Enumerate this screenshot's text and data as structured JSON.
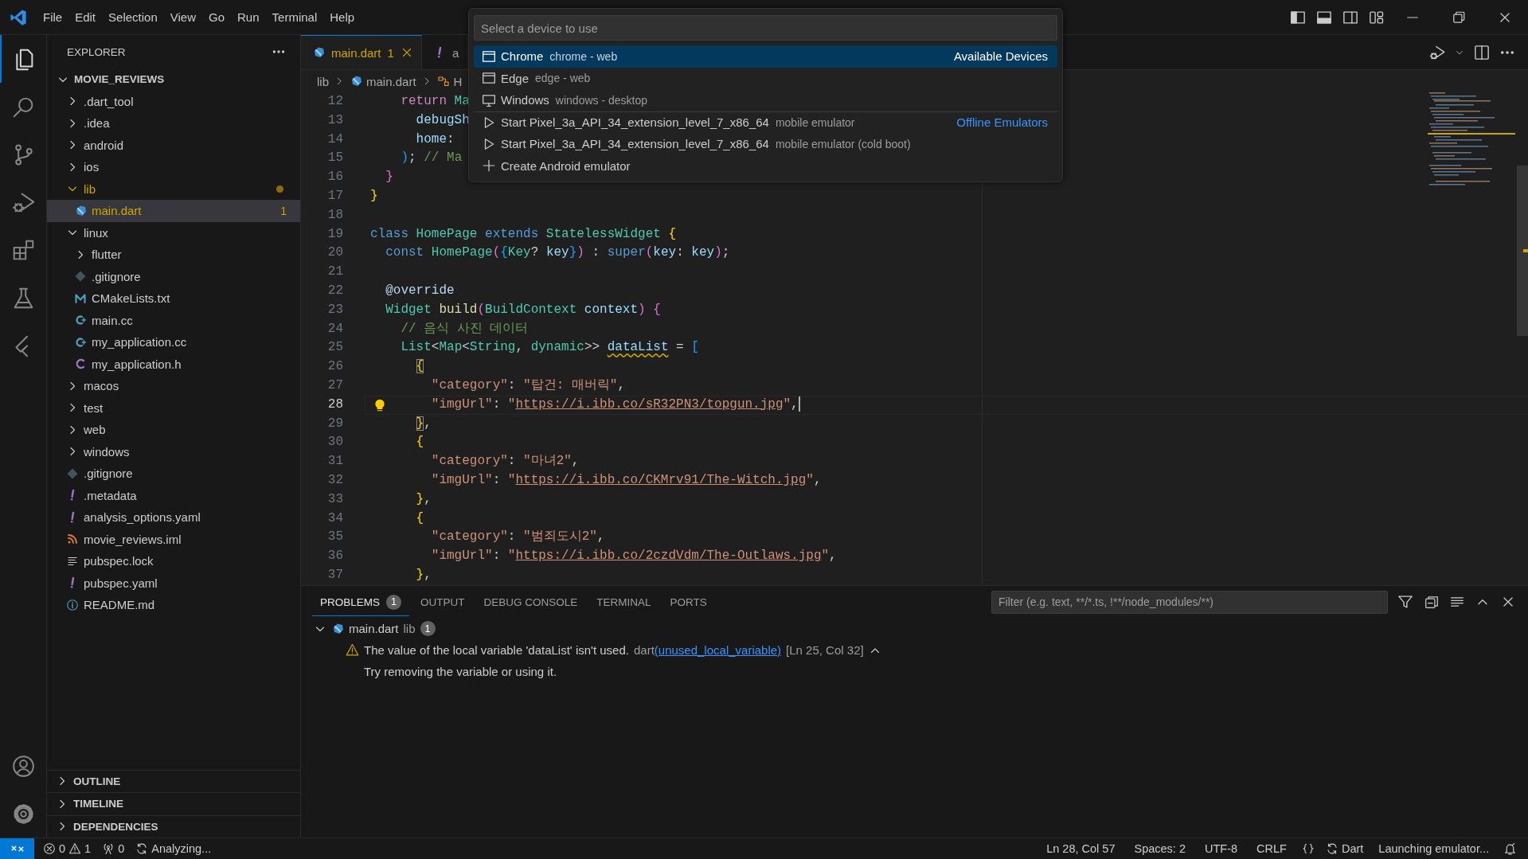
{
  "menu": [
    "File",
    "Edit",
    "Selection",
    "View",
    "Go",
    "Run",
    "Terminal",
    "Help"
  ],
  "activity_bar": [
    {
      "kind": "explorer",
      "selected": true
    },
    {
      "kind": "search",
      "selected": false
    },
    {
      "kind": "source-control",
      "selected": false
    },
    {
      "kind": "run-debug",
      "selected": false
    },
    {
      "kind": "extensions",
      "selected": false
    },
    {
      "kind": "testing",
      "selected": false
    },
    {
      "kind": "flutter",
      "selected": false
    }
  ],
  "sidebar": {
    "title": "EXPLORER",
    "root": {
      "label": "MOVIE_REVIEWS",
      "expanded": true
    },
    "tree": [
      {
        "label": ".dart_tool",
        "kind": "folder",
        "expanded": false,
        "selected": false,
        "has_problems": false
      },
      {
        "label": ".idea",
        "kind": "folder",
        "expanded": false,
        "selected": false,
        "has_problems": false
      },
      {
        "label": "android",
        "kind": "folder",
        "expanded": false,
        "selected": false,
        "has_problems": false
      },
      {
        "label": "ios",
        "kind": "folder",
        "expanded": false,
        "selected": false,
        "has_problems": false
      },
      {
        "label": "lib",
        "kind": "folder",
        "expanded": true,
        "selected": false,
        "has_problems": true,
        "children": [
          {
            "label": "main.dart",
            "kind": "dart",
            "selected": true,
            "has_problems": true,
            "badge": "1"
          }
        ]
      },
      {
        "label": "linux",
        "kind": "folder",
        "expanded": true,
        "selected": false,
        "has_problems": false,
        "children": [
          {
            "label": "flutter",
            "kind": "folder",
            "expanded": false,
            "selected": false,
            "has_problems": false
          },
          {
            "label": ".gitignore",
            "kind": "gitignore",
            "selected": false,
            "has_problems": false
          },
          {
            "label": "CMakeLists.txt",
            "kind": "cmake",
            "selected": false,
            "has_problems": false
          },
          {
            "label": "main.cc",
            "kind": "cpp",
            "selected": false,
            "has_problems": false
          },
          {
            "label": "my_application.cc",
            "kind": "cpp",
            "selected": false,
            "has_problems": false
          },
          {
            "label": "my_application.h",
            "kind": "header",
            "selected": false,
            "has_problems": false
          }
        ]
      },
      {
        "label": "macos",
        "kind": "folder",
        "expanded": false,
        "selected": false,
        "has_problems": false
      },
      {
        "label": "test",
        "kind": "folder",
        "expanded": false,
        "selected": false,
        "has_problems": false
      },
      {
        "label": "web",
        "kind": "folder",
        "expanded": false,
        "selected": false,
        "has_problems": false
      },
      {
        "label": "windows",
        "kind": "folder",
        "expanded": false,
        "selected": false,
        "has_problems": false
      },
      {
        "label": ".gitignore",
        "kind": "gitignore",
        "selected": false,
        "has_problems": false
      },
      {
        "label": ".metadata",
        "kind": "yaml",
        "selected": false,
        "has_problems": false
      },
      {
        "label": "analysis_options.yaml",
        "kind": "yaml",
        "selected": false,
        "has_problems": false
      },
      {
        "label": "movie_reviews.iml",
        "kind": "iml",
        "selected": false,
        "has_problems": false
      },
      {
        "label": "pubspec.lock",
        "kind": "lock",
        "selected": false,
        "has_problems": false
      },
      {
        "label": "pubspec.yaml",
        "kind": "yaml",
        "selected": false,
        "has_problems": false
      },
      {
        "label": "README.md",
        "kind": "markdown",
        "selected": false,
        "has_problems": false
      }
    ],
    "sections": [
      {
        "label": "OUTLINE",
        "expanded": false
      },
      {
        "label": "TIMELINE",
        "expanded": false
      },
      {
        "label": "DEPENDENCIES",
        "expanded": false
      }
    ]
  },
  "editor": {
    "tabs": [
      {
        "label": "main.dart",
        "kind": "dart",
        "badge": "1",
        "selected": true
      },
      {
        "label": "a",
        "kind": "yaml",
        "selected": false
      }
    ],
    "breadcrumb": [
      {
        "label": "lib",
        "kind": "folder"
      },
      {
        "label": "main.dart",
        "kind": "dart"
      },
      {
        "label": "H",
        "kind": "class"
      }
    ],
    "lines": [
      {
        "number": "12",
        "current": false,
        "lightbulb": false,
        "tokens": [
          {
            "text": "    return",
            "kind": "ctrl"
          },
          {
            "text": " Ma",
            "kind": "type"
          }
        ]
      },
      {
        "number": "13",
        "current": false,
        "lightbulb": false,
        "tokens": [
          {
            "text": "      debugSh",
            "kind": "var"
          }
        ]
      },
      {
        "number": "14",
        "current": false,
        "lightbulb": false,
        "tokens": [
          {
            "text": "      home",
            "kind": "var"
          },
          {
            "text": ":",
            "kind": "punc"
          }
        ]
      },
      {
        "number": "15",
        "current": false,
        "lightbulb": false,
        "tokens": [
          {
            "text": "    )",
            "kind": "b3"
          },
          {
            "text": ";",
            "kind": "punc"
          },
          {
            "text": " // Ma",
            "kind": "com"
          }
        ]
      },
      {
        "number": "16",
        "current": false,
        "lightbulb": false,
        "tokens": [
          {
            "text": "  }",
            "kind": "b2"
          }
        ]
      },
      {
        "number": "17",
        "current": false,
        "lightbulb": false,
        "tokens": [
          {
            "text": "}",
            "kind": "b1"
          }
        ]
      },
      {
        "number": "18",
        "current": false,
        "lightbulb": false
      },
      {
        "number": "19",
        "current": false,
        "lightbulb": false,
        "tokens": [
          {
            "text": "class",
            "kind": "kw"
          },
          {
            "text": " HomePage",
            "kind": "type"
          },
          {
            "text": " extends",
            "kind": "kw"
          },
          {
            "text": " StatelessWidget",
            "kind": "type"
          },
          {
            "text": " {",
            "kind": "b1"
          }
        ]
      },
      {
        "number": "20",
        "current": false,
        "lightbulb": false,
        "tokens": [
          {
            "text": "  const",
            "kind": "kw"
          },
          {
            "text": " HomePage",
            "kind": "type"
          },
          {
            "text": "(",
            "kind": "b2"
          },
          {
            "text": "{",
            "kind": "b3"
          },
          {
            "text": "Key",
            "kind": "type"
          },
          {
            "text": "? ",
            "kind": "punc"
          },
          {
            "text": "key",
            "kind": "var"
          },
          {
            "text": "}",
            "kind": "b3"
          },
          {
            "text": ")",
            "kind": "b2"
          },
          {
            "text": " : ",
            "kind": "punc"
          },
          {
            "text": "super",
            "kind": "kw"
          },
          {
            "text": "(",
            "kind": "b2"
          },
          {
            "text": "key",
            "kind": "var"
          },
          {
            "text": ": ",
            "kind": "punc"
          },
          {
            "text": "key",
            "kind": "var"
          },
          {
            "text": ")",
            "kind": "b2"
          },
          {
            "text": ";",
            "kind": "punc"
          }
        ]
      },
      {
        "number": "21",
        "current": false,
        "lightbulb": false
      },
      {
        "number": "22",
        "current": false,
        "lightbulb": false,
        "tokens": [
          {
            "text": "  @override",
            "kind": "meta"
          }
        ]
      },
      {
        "number": "23",
        "current": false,
        "lightbulb": false,
        "tokens": [
          {
            "text": "  Widget",
            "kind": "type"
          },
          {
            "text": " build",
            "kind": "fn"
          },
          {
            "text": "(",
            "kind": "b2"
          },
          {
            "text": "BuildContext",
            "kind": "type"
          },
          {
            "text": " context",
            "kind": "var"
          },
          {
            "text": ")",
            "kind": "b2"
          },
          {
            "text": " {",
            "kind": "b2"
          }
        ]
      },
      {
        "number": "24",
        "current": false,
        "lightbulb": false,
        "tokens": [
          {
            "text": "    // 음식 사진 데이터",
            "kind": "com"
          }
        ]
      },
      {
        "number": "25",
        "current": false,
        "lightbulb": false,
        "tokens": [
          {
            "text": "    List",
            "kind": "type"
          },
          {
            "text": "<",
            "kind": "punc"
          },
          {
            "text": "Map",
            "kind": "type"
          },
          {
            "text": "<",
            "kind": "punc"
          },
          {
            "text": "String",
            "kind": "type"
          },
          {
            "text": ", ",
            "kind": "punc"
          },
          {
            "text": "dynamic",
            "kind": "type"
          },
          {
            "text": ">> ",
            "kind": "punc"
          },
          {
            "text": "dataList",
            "kind": "warn"
          },
          {
            "text": " = ",
            "kind": "punc"
          },
          {
            "text": "[",
            "kind": "b3"
          }
        ]
      },
      {
        "number": "26",
        "current": false,
        "lightbulb": false,
        "tokens": [
          {
            "text": "      {",
            "kind": "match"
          }
        ]
      },
      {
        "number": "27",
        "current": false,
        "lightbulb": false,
        "tokens": [
          {
            "text": "        \"category\"",
            "kind": "str"
          },
          {
            "text": ": ",
            "kind": "punc"
          },
          {
            "text": "\"탑건: 매버릭\"",
            "kind": "str"
          },
          {
            "text": ",",
            "kind": "punc"
          }
        ]
      },
      {
        "number": "28",
        "current": true,
        "lightbulb": true,
        "tokens": [
          {
            "text": "        \"imgUrl\"",
            "kind": "str"
          },
          {
            "text": ": ",
            "kind": "punc"
          },
          {
            "text": "\"",
            "kind": "str"
          },
          {
            "text": "https://i.ibb.co/sR32PN3/topgun.jpg",
            "kind": "link"
          },
          {
            "text": "\"",
            "kind": "str"
          },
          {
            "text": ",",
            "kind": "punc"
          }
        ]
      },
      {
        "number": "29",
        "current": false,
        "lightbulb": false,
        "tokens": [
          {
            "text": "      }",
            "kind": "match"
          },
          {
            "text": ",",
            "kind": "punc"
          }
        ]
      },
      {
        "number": "30",
        "current": false,
        "lightbulb": false,
        "tokens": [
          {
            "text": "      {",
            "kind": "b1"
          }
        ]
      },
      {
        "number": "31",
        "current": false,
        "lightbulb": false,
        "tokens": [
          {
            "text": "        \"category\"",
            "kind": "str"
          },
          {
            "text": ": ",
            "kind": "punc"
          },
          {
            "text": "\"마녀2\"",
            "kind": "str"
          },
          {
            "text": ",",
            "kind": "punc"
          }
        ]
      },
      {
        "number": "32",
        "current": false,
        "lightbulb": false,
        "tokens": [
          {
            "text": "        \"imgUrl\"",
            "kind": "str"
          },
          {
            "text": ": ",
            "kind": "punc"
          },
          {
            "text": "\"",
            "kind": "str"
          },
          {
            "text": "https://i.ibb.co/CKMrv91/The-Witch.jpg",
            "kind": "link"
          },
          {
            "text": "\"",
            "kind": "str"
          },
          {
            "text": ",",
            "kind": "punc"
          }
        ]
      },
      {
        "number": "33",
        "current": false,
        "lightbulb": false,
        "tokens": [
          {
            "text": "      }",
            "kind": "b1"
          },
          {
            "text": ",",
            "kind": "punc"
          }
        ]
      },
      {
        "number": "34",
        "current": false,
        "lightbulb": false,
        "tokens": [
          {
            "text": "      {",
            "kind": "b1"
          }
        ]
      },
      {
        "number": "35",
        "current": false,
        "lightbulb": false,
        "tokens": [
          {
            "text": "        \"category\"",
            "kind": "str"
          },
          {
            "text": ": ",
            "kind": "punc"
          },
          {
            "text": "\"범죄도시2\"",
            "kind": "str"
          },
          {
            "text": ",",
            "kind": "punc"
          }
        ]
      },
      {
        "number": "36",
        "current": false,
        "lightbulb": false,
        "tokens": [
          {
            "text": "        \"imgUrl\"",
            "kind": "str"
          },
          {
            "text": ": ",
            "kind": "punc"
          },
          {
            "text": "\"",
            "kind": "str"
          },
          {
            "text": "https://i.ibb.co/2czdVdm/The-Outlaws.jpg",
            "kind": "link"
          },
          {
            "text": "\"",
            "kind": "str"
          },
          {
            "text": ",",
            "kind": "punc"
          }
        ]
      },
      {
        "number": "37",
        "current": false,
        "lightbulb": false,
        "tokens": [
          {
            "text": "      }",
            "kind": "b1"
          },
          {
            "text": ",",
            "kind": "punc"
          }
        ]
      }
    ]
  },
  "quick_pick": {
    "placeholder": "Select a device to use",
    "items": [
      {
        "kind": "browser",
        "label": "Chrome",
        "description": "chrome - web",
        "group": "Available Devices",
        "selected": true
      },
      {
        "kind": "browser",
        "label": "Edge",
        "description": "edge - web",
        "selected": false
      },
      {
        "kind": "desktop",
        "label": "Windows",
        "description": "windows - desktop",
        "selected": false
      },
      {
        "kind": "emulator",
        "label": "Start Pixel_3a_API_34_extension_level_7_x86_64",
        "description": "mobile emulator",
        "group": "Offline Emulators",
        "selected": false
      },
      {
        "kind": "emulator",
        "label": "Start Pixel_3a_API_34_extension_level_7_x86_64",
        "description": "mobile emulator (cold boot)",
        "selected": false
      },
      {
        "kind": "create",
        "label": "Create Android emulator",
        "selected": false
      }
    ]
  },
  "panel": {
    "tabs": [
      {
        "label": "PROBLEMS",
        "badge": "1",
        "selected": true
      },
      {
        "label": "OUTPUT",
        "selected": false
      },
      {
        "label": "DEBUG CONSOLE",
        "selected": false
      },
      {
        "label": "TERMINAL",
        "selected": false
      },
      {
        "label": "PORTS",
        "selected": false
      }
    ],
    "filter_placeholder": "Filter (e.g. text, **/*.ts, !**/node_modules/**)",
    "problems": [
      {
        "file": "main.dart",
        "folder": "lib",
        "count": "1",
        "expanded": true,
        "items": [
          {
            "kind": "warning",
            "message": "The value of the local variable 'dataList' isn't used.",
            "source": "dart",
            "code": "(unused_local_variable)",
            "position": "[Ln 25, Col 32]",
            "expanded": true,
            "detail": "Try removing the variable or using it."
          }
        ]
      }
    ]
  },
  "status_bar": {
    "errors": "0",
    "warnings": "1",
    "ports": "0",
    "progress": "Analyzing...",
    "cursor": "Ln 28, Col 57",
    "indentation": "Spaces: 2",
    "encoding": "UTF-8",
    "eol": "CRLF",
    "language": "Dart",
    "notification": "Launching emulator..."
  }
}
